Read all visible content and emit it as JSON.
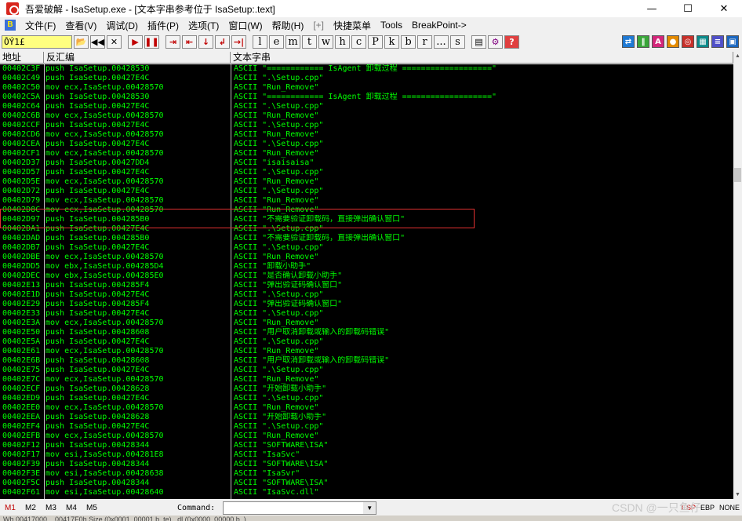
{
  "window": {
    "title": "吾爱破解 - IsaSetup.exe - [文本字串参考位于 IsaSetup:.text]",
    "minimize": "—",
    "maximize": "☐",
    "close": "✕"
  },
  "menu": {
    "icon_label": "B",
    "items": [
      "文件(F)",
      "查看(V)",
      "调试(D)",
      "插件(P)",
      "选项(T)",
      "窗口(W)",
      "帮助(H)",
      "[+]",
      "快捷菜单",
      "Tools",
      "BreakPoint->"
    ]
  },
  "toolbar": {
    "command_value": "ÔÝ1£",
    "nav_buttons": [
      "📂",
      "◀◀",
      "✕",
      "▶",
      "❚❚",
      "⇥",
      "⇤",
      "↓",
      "↲",
      "→|"
    ],
    "letters": [
      "l",
      "e",
      "m",
      "t",
      "w",
      "h",
      "c",
      "P",
      "k",
      "b",
      "r",
      "...",
      "s"
    ],
    "right_icons": [
      {
        "label": "⇄",
        "color": "#1f7ad4"
      },
      {
        "label": "‖",
        "color": "#3aa63a"
      },
      {
        "label": "A",
        "color": "#d4267a"
      },
      {
        "label": "●",
        "color": "#e38a00"
      },
      {
        "label": "◎",
        "color": "#c8302a"
      },
      {
        "label": "▦",
        "color": "#0b8a8a"
      },
      {
        "label": "≡",
        "color": "#5050c8"
      },
      {
        "label": "▣",
        "color": "#1a66bf"
      }
    ]
  },
  "columns": {
    "address": "地址",
    "disasm": "反汇编",
    "text": "文本字串"
  },
  "rows": [
    {
      "addr": "00402C3F",
      "dis": "push IsaSetup.00428530",
      "txt": "ASCII \"============ IsAgent 卸载过程 ===================\""
    },
    {
      "addr": "00402C49",
      "dis": "push IsaSetup.00427E4C",
      "txt": "ASCII \".\\Setup.cpp\""
    },
    {
      "addr": "00402C50",
      "dis": "mov ecx,IsaSetup.00428570",
      "txt": "ASCII \"Run_Remove\""
    },
    {
      "addr": "00402C5A",
      "dis": "push IsaSetup.00428530",
      "txt": "ASCII \"============ IsAgent 卸载过程 ===================\""
    },
    {
      "addr": "00402C64",
      "dis": "push IsaSetup.00427E4C",
      "txt": "ASCII \".\\Setup.cpp\""
    },
    {
      "addr": "00402C6B",
      "dis": "mov ecx,IsaSetup.00428570",
      "txt": "ASCII \"Run_Remove\""
    },
    {
      "addr": "00402CCF",
      "dis": "push IsaSetup.00427E4C",
      "txt": "ASCII \".\\Setup.cpp\""
    },
    {
      "addr": "00402CD6",
      "dis": "mov ecx,IsaSetup.00428570",
      "txt": "ASCII \"Run_Remove\""
    },
    {
      "addr": "00402CEA",
      "dis": "push IsaSetup.00427E4C",
      "txt": "ASCII \".\\Setup.cpp\""
    },
    {
      "addr": "00402CF1",
      "dis": "mov ecx,IsaSetup.00428570",
      "txt": "ASCII \"Run_Remove\""
    },
    {
      "addr": "00402D37",
      "dis": "push IsaSetup.00427DD4",
      "txt": "ASCII \"isaisaisa\""
    },
    {
      "addr": "00402D57",
      "dis": "push IsaSetup.00427E4C",
      "txt": "ASCII \".\\Setup.cpp\""
    },
    {
      "addr": "00402D5E",
      "dis": "mov ecx,IsaSetup.00428570",
      "txt": "ASCII \"Run_Remove\""
    },
    {
      "addr": "00402D72",
      "dis": "push IsaSetup.00427E4C",
      "txt": "ASCII \".\\Setup.cpp\""
    },
    {
      "addr": "00402D79",
      "dis": "mov ecx,IsaSetup.00428570",
      "txt": "ASCII \"Run_Remove\""
    },
    {
      "addr": "00402D8C",
      "dis": "mov ecx,IsaSetup.00428570",
      "txt": "ASCII \"Run_Remove\""
    },
    {
      "addr": "00402D97",
      "dis": "push IsaSetup.004285B0",
      "txt": "ASCII \"不需要验证卸载码，直接弹出确认窗口\""
    },
    {
      "addr": "00402DA1",
      "dis": "push IsaSetup.00427E4C",
      "txt": "ASCII \".\\Setup.cpp\""
    },
    {
      "addr": "00402DAD",
      "dis": "push IsaSetup.004285B0",
      "txt": "ASCII \"不需要验证卸载码，直接弹出确认窗口\""
    },
    {
      "addr": "00402DB7",
      "dis": "push IsaSetup.00427E4C",
      "txt": "ASCII \".\\Setup.cpp\""
    },
    {
      "addr": "00402DBE",
      "dis": "mov ecx,IsaSetup.00428570",
      "txt": "ASCII \"Run_Remove\""
    },
    {
      "addr": "00402DD5",
      "dis": "mov ebx,IsaSetup.004285D4",
      "txt": "ASCII \"卸载小助手\""
    },
    {
      "addr": "00402DEC",
      "dis": "mov ebx,IsaSetup.004285E0",
      "txt": "ASCII \"是否确认卸载小助手\""
    },
    {
      "addr": "00402E13",
      "dis": "push IsaSetup.004285F4",
      "txt": "ASCII \"弹出验证码确认窗口\""
    },
    {
      "addr": "00402E1D",
      "dis": "push IsaSetup.00427E4C",
      "txt": "ASCII \".\\Setup.cpp\""
    },
    {
      "addr": "00402E29",
      "dis": "push IsaSetup.004285F4",
      "txt": "ASCII \"弹出验证码确认窗口\""
    },
    {
      "addr": "00402E33",
      "dis": "push IsaSetup.00427E4C",
      "txt": "ASCII \".\\Setup.cpp\""
    },
    {
      "addr": "00402E3A",
      "dis": "mov ecx,IsaSetup.00428570",
      "txt": "ASCII \"Run_Remove\""
    },
    {
      "addr": "00402E50",
      "dis": "push IsaSetup.00428608",
      "txt": "ASCII \"用户取消卸载或输入的卸载码错误\""
    },
    {
      "addr": "00402E5A",
      "dis": "push IsaSetup.00427E4C",
      "txt": "ASCII \".\\Setup.cpp\""
    },
    {
      "addr": "00402E61",
      "dis": "mov ecx,IsaSetup.00428570",
      "txt": "ASCII \"Run_Remove\""
    },
    {
      "addr": "00402E6B",
      "dis": "push IsaSetup.00428608",
      "txt": "ASCII \"用户取消卸载或输入的卸载码错误\""
    },
    {
      "addr": "00402E75",
      "dis": "push IsaSetup.00427E4C",
      "txt": "ASCII \".\\Setup.cpp\""
    },
    {
      "addr": "00402E7C",
      "dis": "mov ecx,IsaSetup.00428570",
      "txt": "ASCII \"Run_Remove\""
    },
    {
      "addr": "00402ECF",
      "dis": "push IsaSetup.00428628",
      "txt": "ASCII \"开始卸载小助手\""
    },
    {
      "addr": "00402ED9",
      "dis": "push IsaSetup.00427E4C",
      "txt": "ASCII \".\\Setup.cpp\""
    },
    {
      "addr": "00402EE0",
      "dis": "mov ecx,IsaSetup.00428570",
      "txt": "ASCII \"Run_Remove\""
    },
    {
      "addr": "00402EEA",
      "dis": "push IsaSetup.00428628",
      "txt": "ASCII \"开始卸载小助手\""
    },
    {
      "addr": "00402EF4",
      "dis": "push IsaSetup.00427E4C",
      "txt": "ASCII \".\\Setup.cpp\""
    },
    {
      "addr": "00402EFB",
      "dis": "mov ecx,IsaSetup.00428570",
      "txt": "ASCII \"Run_Remove\""
    },
    {
      "addr": "00402F12",
      "dis": "push IsaSetup.00428344",
      "txt": "ASCII \"SOFTWARE\\ISA\""
    },
    {
      "addr": "00402F17",
      "dis": "mov esi,IsaSetup.004281E8",
      "txt": "ASCII \"IsaSvc\""
    },
    {
      "addr": "00402F39",
      "dis": "push IsaSetup.00428344",
      "txt": "ASCII \"SOFTWARE\\ISA\""
    },
    {
      "addr": "00402F3E",
      "dis": "mov esi,IsaSetup.00428638",
      "txt": "ASCII \"IsaSvr\""
    },
    {
      "addr": "00402F5C",
      "dis": "push IsaSetup.00428344",
      "txt": "ASCII \"SOFTWARE\\ISA\""
    },
    {
      "addr": "00402F61",
      "dis": "mov esi,IsaSetup.00428640",
      "txt": "ASCII \"IsaSvc.dll\""
    }
  ],
  "bottom": {
    "tabs": [
      "M1",
      "M2",
      "M3",
      "M4",
      "M5"
    ],
    "command_label": "Command:",
    "registers": [
      "ESP",
      "EBP",
      "NONE"
    ],
    "watermark": "CSDN @一只鱼仔",
    "status_text": "Wh  00417000  ..  00417F0h       Size (0x0001..00001 b..te)   ..dl  (0x0000..00000 b..)"
  }
}
